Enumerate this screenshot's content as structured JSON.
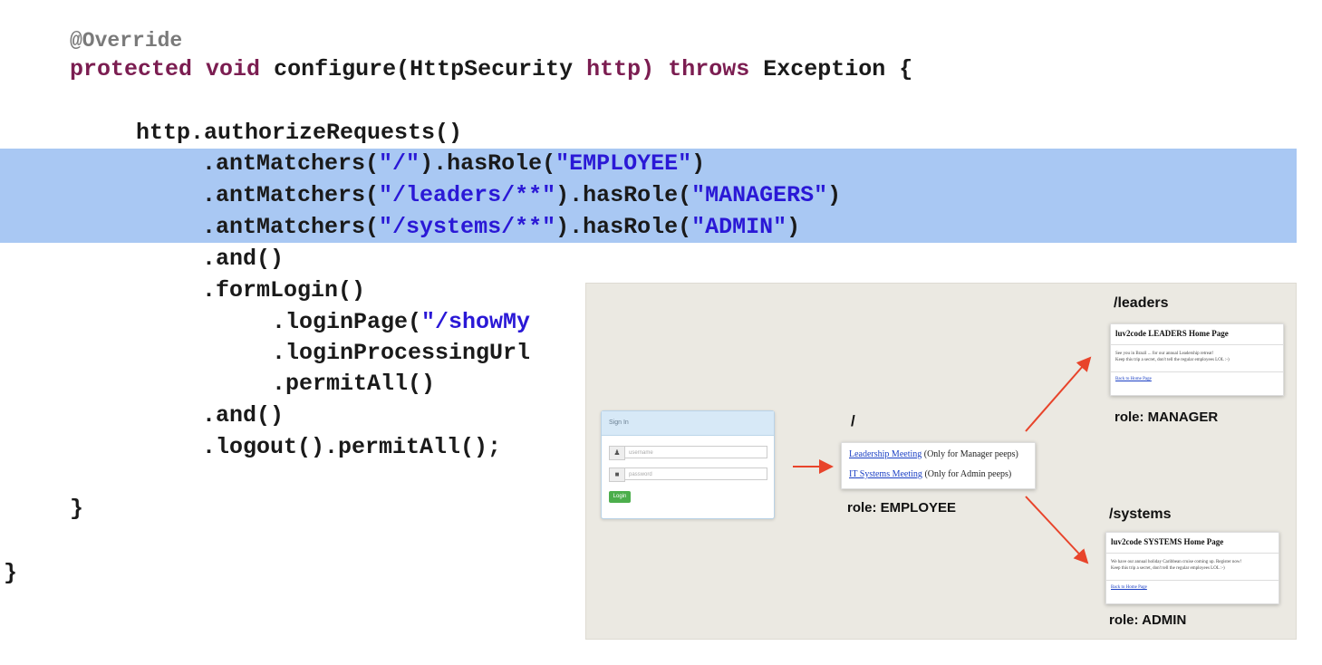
{
  "code": {
    "annotation": "@Override",
    "signature": {
      "modifier": "protected",
      "return_type": "void",
      "method": "configure(HttpSecurity",
      "param": "http)",
      "throws_kw": "throws",
      "exception": "Exception {"
    },
    "lines": {
      "l3": "http.authorizeRequests()",
      "l4_pre": ".antMatchers(",
      "l4_s1": "\"/\"",
      "l4_mid": ").hasRole(",
      "l4_s2": "\"EMPLOYEE\"",
      "l4_end": ")",
      "l5_pre": ".antMatchers(",
      "l5_s1": "\"/leaders/**\"",
      "l5_mid": ").hasRole(",
      "l5_s2": "\"MANAGERS\"",
      "l5_end": ")",
      "l6_pre": ".antMatchers(",
      "l6_s1": "\"/systems/**\"",
      "l6_mid": ").hasRole(",
      "l6_s2": "\"ADMIN\"",
      "l6_end": ")",
      "l7": ".and()",
      "l8": ".formLogin()",
      "l9_pre": ".loginPage(",
      "l9_s": "\"/showMy",
      "l10": ".loginProcessingUrl",
      "l11": ".permitAll()",
      "l12": ".and()",
      "l13": ".logout().permitAll();",
      "close_inner": "}",
      "close_outer": "}"
    }
  },
  "diagram": {
    "login": {
      "header": "Sign In",
      "username_placeholder": "username",
      "password_placeholder": "password",
      "button": "Login",
      "user_icon": "user-icon",
      "lock_icon": "lock-icon"
    },
    "employee": {
      "path": "/",
      "link1": "Leadership Meeting",
      "link1_note": "(Only for Manager peeps)",
      "link2": "IT Systems Meeting",
      "link2_note": "(Only for Admin peeps)",
      "role": "role: EMPLOYEE"
    },
    "leaders": {
      "path": "/leaders",
      "title": "luv2code LEADERS Home Page",
      "desc1": "See you in Brazil ... for our annual Leadership retreat!",
      "desc2": "Keep this trip a secret, don't tell the regular employees LOL :-)",
      "back": "Back to Home Page",
      "role": "role: MANAGER"
    },
    "systems": {
      "path": "/systems",
      "title": "luv2code SYSTEMS Home Page",
      "desc1": "We have our annual holiday Caribbean cruise coming up. Register now!",
      "desc2": "Keep this trip a secret, don't tell the regular employees LOL :-)",
      "back": "Back to Home Page",
      "role": "role: ADMIN"
    },
    "colors": {
      "arrow": "#e8442b",
      "highlight": "#a9c8f3",
      "keyword": "#7b1d51",
      "string": "#2a18d6"
    }
  }
}
